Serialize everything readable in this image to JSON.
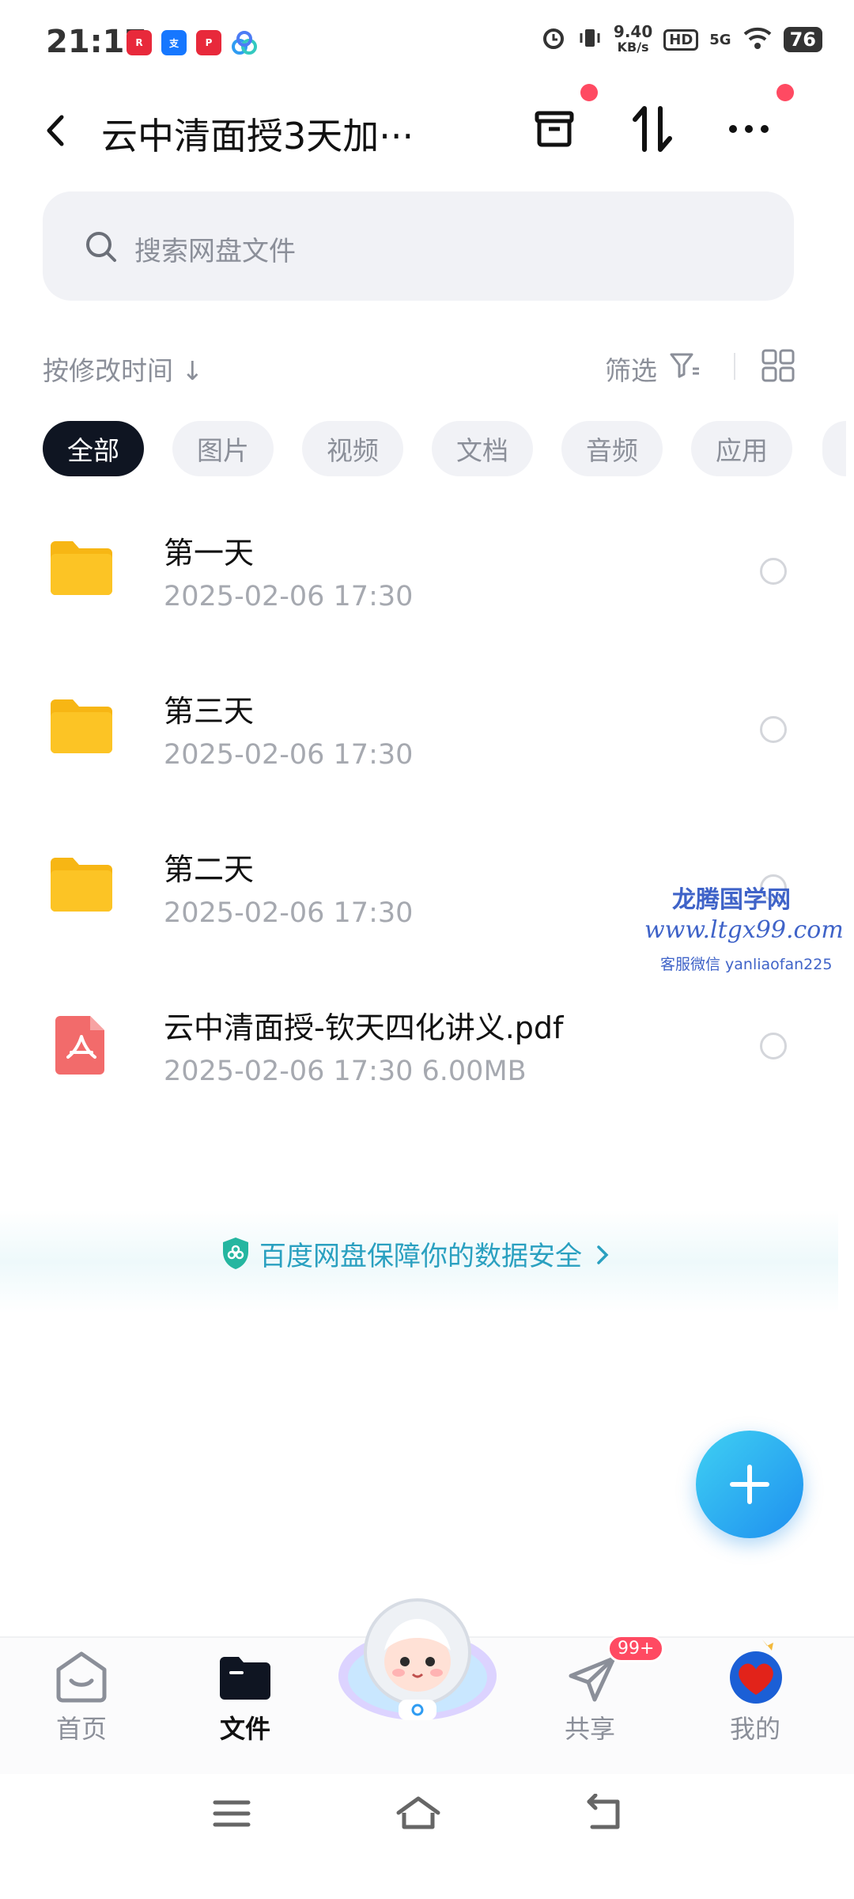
{
  "status_bar": {
    "time": "21:17",
    "net_speed_value": "9.40",
    "net_speed_unit": "KB/s",
    "hd": "HD",
    "signal": "5G",
    "battery": "76"
  },
  "header": {
    "title": "云中清面授3天加···"
  },
  "search": {
    "placeholder": "搜索网盘文件"
  },
  "sort": {
    "label": "按修改时间 ↓",
    "filter_label": "筛选"
  },
  "chips": [
    "全部",
    "图片",
    "视频",
    "文档",
    "音频",
    "应用"
  ],
  "files": [
    {
      "name": "第一天",
      "meta": "2025-02-06  17:30",
      "type": "folder"
    },
    {
      "name": "第三天",
      "meta": "2025-02-06  17:30",
      "type": "folder"
    },
    {
      "name": "第二天",
      "meta": "2025-02-06  17:30",
      "type": "folder"
    },
    {
      "name": "云中清面授-钦天四化讲义.pdf",
      "meta": "2025-02-06  17:30   6.00MB",
      "type": "pdf"
    }
  ],
  "watermark": {
    "line1": "龙腾国学网",
    "line2": "www.ltgx99.com",
    "line3": "客服微信 yanliaofan225"
  },
  "safety_banner": "百度网盘保障你的数据安全",
  "bottom_nav": {
    "home": "首页",
    "files": "文件",
    "share": "共享",
    "share_badge": "99+",
    "mine": "我的"
  },
  "colors": {
    "accent": "#1e8ff0",
    "chip_active": "#0f1522",
    "folder": "#fcc425",
    "pdf": "#f26b6b",
    "badge": "#ff4a62"
  }
}
